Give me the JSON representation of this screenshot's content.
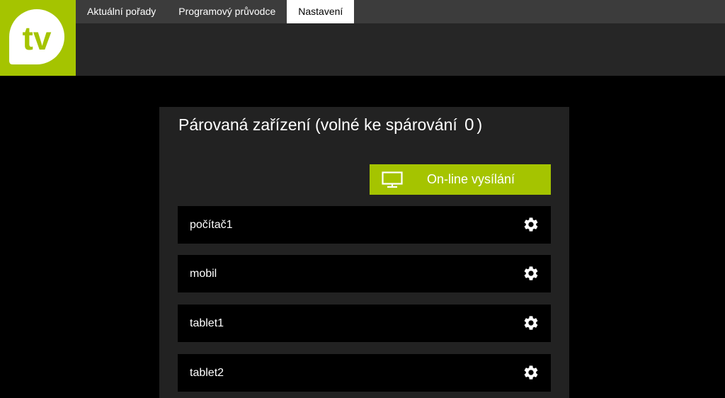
{
  "logo": {
    "text": "tv",
    "brand_color": "#a5c400"
  },
  "nav": {
    "tabs": [
      {
        "label": "Aktuální pořady"
      },
      {
        "label": "Programový průvodce"
      },
      {
        "label": "Nastavení",
        "active": true
      }
    ]
  },
  "panel": {
    "title_prefix": "Párovaná zařízení (volné ke spárování",
    "free_count": "0",
    "title_suffix": ")",
    "online_button": {
      "label": "On-line vysílání",
      "icon": "monitor-icon"
    },
    "devices": [
      {
        "name": "počítač1",
        "icon": "gear-icon"
      },
      {
        "name": "mobil",
        "icon": "gear-icon"
      },
      {
        "name": "tablet1",
        "icon": "gear-icon"
      },
      {
        "name": "tablet2",
        "icon": "gear-icon"
      }
    ]
  }
}
